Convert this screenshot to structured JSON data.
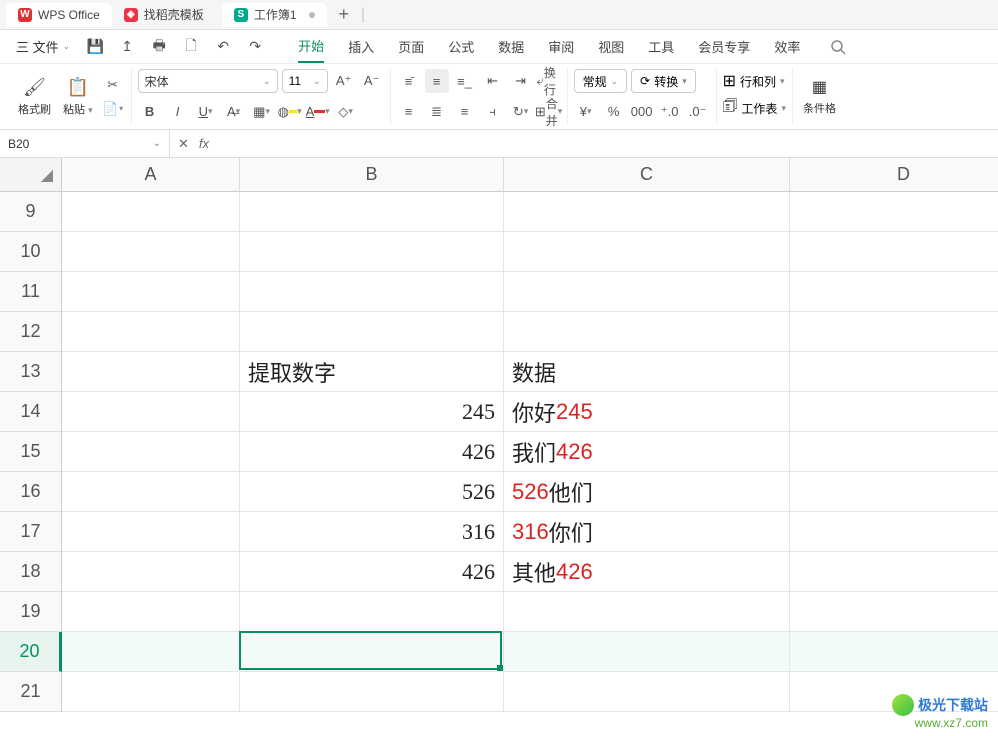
{
  "titlebar": {
    "tabs": [
      {
        "icon": "W",
        "label": "WPS Office",
        "kind": "office"
      },
      {
        "icon": "D",
        "label": "找稻壳模板",
        "kind": "tpl"
      },
      {
        "icon": "S",
        "label": "工作簿1",
        "kind": "doc"
      }
    ]
  },
  "menubar": {
    "file": "三 文件",
    "tabs": [
      "开始",
      "插入",
      "页面",
      "公式",
      "数据",
      "审阅",
      "视图",
      "工具",
      "会员专享",
      "效率"
    ]
  },
  "ribbon": {
    "format_brush": "格式刷",
    "paste": "粘贴",
    "font_family": "宋体",
    "font_size": "11",
    "wrap": "换行",
    "merge": "合并",
    "number_format": "常规",
    "convert": "转换",
    "rowcol": "行和列",
    "worksheet": "工作表",
    "cond": "条件格"
  },
  "fxbar": {
    "name": "B20",
    "fx": "fx"
  },
  "grid": {
    "col_widths": {
      "A": 178,
      "B": 264,
      "C": 286,
      "D": 228
    },
    "columns": [
      "A",
      "B",
      "C",
      "D"
    ],
    "rows": [
      9,
      10,
      11,
      12,
      13,
      14,
      15,
      16,
      17,
      18,
      19,
      20,
      21
    ],
    "data": {
      "B13": {
        "text": "提取数字",
        "align": "left"
      },
      "C13": {
        "text": "数据",
        "align": "left"
      },
      "B14": {
        "text": "245",
        "align": "right"
      },
      "C14": {
        "parts": [
          {
            "t": "你好"
          },
          {
            "t": "245",
            "red": true
          }
        ],
        "align": "left"
      },
      "B15": {
        "text": "426",
        "align": "right"
      },
      "C15": {
        "parts": [
          {
            "t": "我们"
          },
          {
            "t": "426",
            "red": true
          }
        ],
        "align": "left"
      },
      "B16": {
        "text": "526",
        "align": "right"
      },
      "C16": {
        "parts": [
          {
            "t": "526",
            "red": true
          },
          {
            "t": "他们"
          }
        ],
        "align": "left"
      },
      "B17": {
        "text": "316",
        "align": "right"
      },
      "C17": {
        "parts": [
          {
            "t": "316",
            "red": true
          },
          {
            "t": "你们"
          }
        ],
        "align": "left"
      },
      "B18": {
        "text": "426",
        "align": "right"
      },
      "C18": {
        "parts": [
          {
            "t": "其他"
          },
          {
            "t": "426",
            "red": true
          }
        ],
        "align": "left"
      }
    },
    "selected": {
      "col": "B",
      "row": 20
    }
  },
  "watermark": {
    "title": "极光下载站",
    "url": "www.xz7.com"
  }
}
